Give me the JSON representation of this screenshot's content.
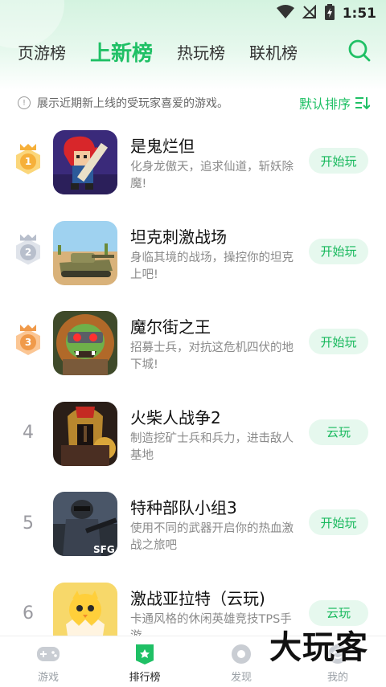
{
  "status_bar": {
    "time": "1:51",
    "icons": [
      "wifi-icon",
      "no-signal-icon",
      "battery-charging-icon"
    ]
  },
  "tabs": [
    {
      "label": "页游榜",
      "active": false
    },
    {
      "label": "上新榜",
      "active": true
    },
    {
      "label": "热玩榜",
      "active": false
    },
    {
      "label": "联机榜",
      "active": false
    }
  ],
  "info": {
    "text": "展示近期新上线的受玩家喜爱的游戏。",
    "sort_label": "默认排序"
  },
  "colors": {
    "accent": "#1fc065",
    "button_bg": "#e6f8ee",
    "gold": "#f6b03a",
    "silver": "#b8bfcc",
    "bronze": "#f09a4a"
  },
  "games": [
    {
      "rank": "1",
      "medal": "gold",
      "title": "是鬼烂但",
      "desc": "化身龙傲天，追求仙道，斩妖除魔!",
      "action": "开始玩"
    },
    {
      "rank": "2",
      "medal": "silver",
      "title": "坦克刺激战场",
      "desc": "身临其境的战场，操控你的坦克上吧!",
      "action": "开始玩"
    },
    {
      "rank": "3",
      "medal": "bronze",
      "title": "魔尔街之王",
      "desc": "招募士兵，对抗这危机四伏的地下城!",
      "action": "开始玩"
    },
    {
      "rank": "4",
      "medal": "",
      "title": "火柴人战争2",
      "desc": "制造挖矿士兵和兵力，进击敌人基地",
      "action": "云玩"
    },
    {
      "rank": "5",
      "medal": "",
      "title": "特种部队小组3",
      "desc": "使用不同的武器开启你的热血激战之旅吧",
      "action": "开始玩"
    },
    {
      "rank": "6",
      "medal": "",
      "title": "激战亚拉特（云玩)",
      "desc": "卡通风格的休闲英雄竞技TPS手游",
      "action": "云玩"
    }
  ],
  "icon_texts": {
    "game5_badge": "SFG"
  },
  "bottom_nav": [
    {
      "label": "游戏",
      "icon": "gamepad-icon",
      "active": false
    },
    {
      "label": "排行榜",
      "icon": "ranking-icon",
      "active": true
    },
    {
      "label": "发现",
      "icon": "discover-icon",
      "active": false
    },
    {
      "label": "我的",
      "icon": "profile-icon",
      "active": false
    }
  ],
  "watermark": "大玩客"
}
